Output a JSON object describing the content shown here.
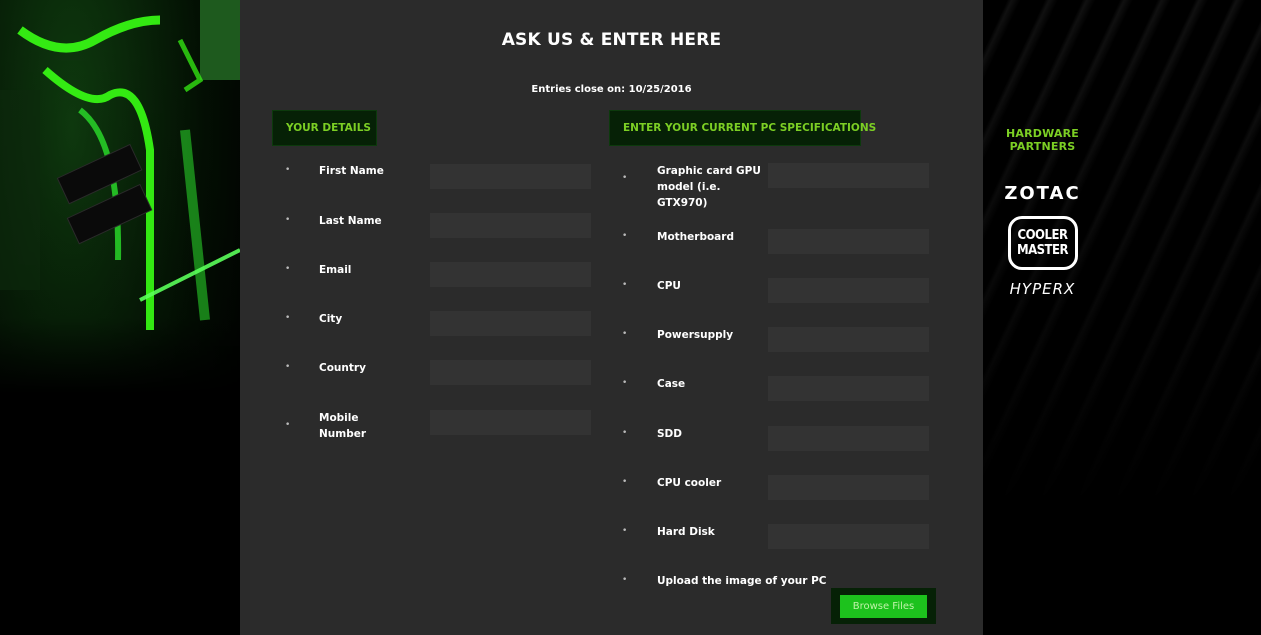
{
  "header": {
    "title": "ASK US & ENTER HERE",
    "entries_close": "Entries close on: 10/25/2016"
  },
  "details_section": {
    "title": "YOUR DETAILS",
    "fields": [
      {
        "label": "First Name",
        "value": ""
      },
      {
        "label": "Last Name",
        "value": ""
      },
      {
        "label": "Email",
        "value": ""
      },
      {
        "label": "City",
        "value": ""
      },
      {
        "label": "Country",
        "value": ""
      },
      {
        "label": "Mobile Number",
        "value": ""
      }
    ]
  },
  "specs_section": {
    "title": "ENTER YOUR CURRENT PC SPECIFICATIONS",
    "fields": [
      {
        "label": "Graphic card GPU model (i.e. GTX970)",
        "value": ""
      },
      {
        "label": "Motherboard",
        "value": ""
      },
      {
        "label": "CPU",
        "value": ""
      },
      {
        "label": "Powersupply",
        "value": ""
      },
      {
        "label": "Case",
        "value": ""
      },
      {
        "label": "SDD",
        "value": ""
      },
      {
        "label": "CPU cooler",
        "value": ""
      },
      {
        "label": "Hard Disk",
        "value": ""
      }
    ],
    "upload_label": "Upload the image of your PC",
    "browse_label": "Browse Files"
  },
  "partners": {
    "title_line1": "HARDWARE",
    "title_line2": "PARTNERS",
    "logos": {
      "zotac": "ZOTAC",
      "coolermaster_line1": "COOLER",
      "coolermaster_line2": "MASTER",
      "hyperx": "HYPERX"
    }
  },
  "colors": {
    "panel_bg": "#2b2b2b",
    "input_bg": "#333333",
    "section_header_bg": "#062106",
    "accent_green": "#7ccf24",
    "button_green": "#1dc21d"
  }
}
